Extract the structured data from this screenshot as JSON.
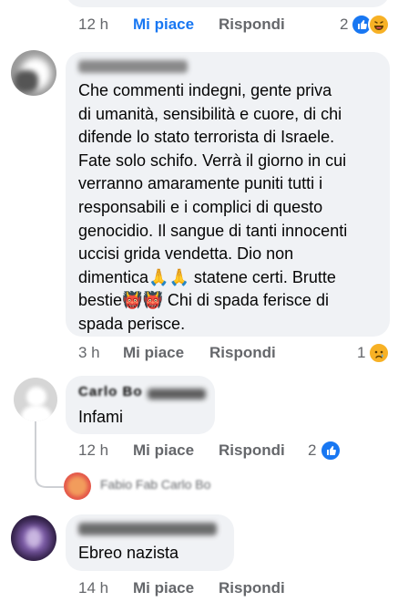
{
  "top_comment": {
    "time": "12 h",
    "like_label": "Mi piace",
    "reply_label": "Rispondi",
    "reactions_count": "2",
    "reactions": [
      "like-icon",
      "laugh-icon"
    ]
  },
  "comment1": {
    "author": "",
    "text": "Che commenti  indegni, gente priva\ndi umanità, sensibilità e cuore, di chi\ndifende lo stato terrorista di Israele.\nFate solo schifo. Verrà il giorno in cui\nverranno amaramente puniti tutti i\nresponsabili e i complici di questo\ngenocidio. Il sangue di tanti innocenti\nuccisi grida vendetta. Dio non\ndimentica🙏🙏 statene certi. Brutte\nbestie👹👹 Chi di spada ferisce di\nspada perisce.",
    "time": "3 h",
    "like_label": "Mi piace",
    "reply_label": "Rispondi",
    "reactions_count": "1",
    "reactions": [
      "sad-icon"
    ]
  },
  "comment2": {
    "author": "Carlo Bo",
    "text": "Infami",
    "time": "12 h",
    "like_label": "Mi piace",
    "reply_label": "Rispondi",
    "reactions_count": "2",
    "reactions": [
      "like-icon"
    ],
    "reply_preview": "Fabio Fab Carlo Bo"
  },
  "comment3": {
    "author": "",
    "text": "Ebreo nazista",
    "time": "14 h",
    "like_label": "Mi piace",
    "reply_label": "Rispondi"
  },
  "colors": {
    "accent": "#1877f2",
    "bubble": "#f0f2f5",
    "meta": "#65676b",
    "sad_reaction": "#f7b125"
  }
}
